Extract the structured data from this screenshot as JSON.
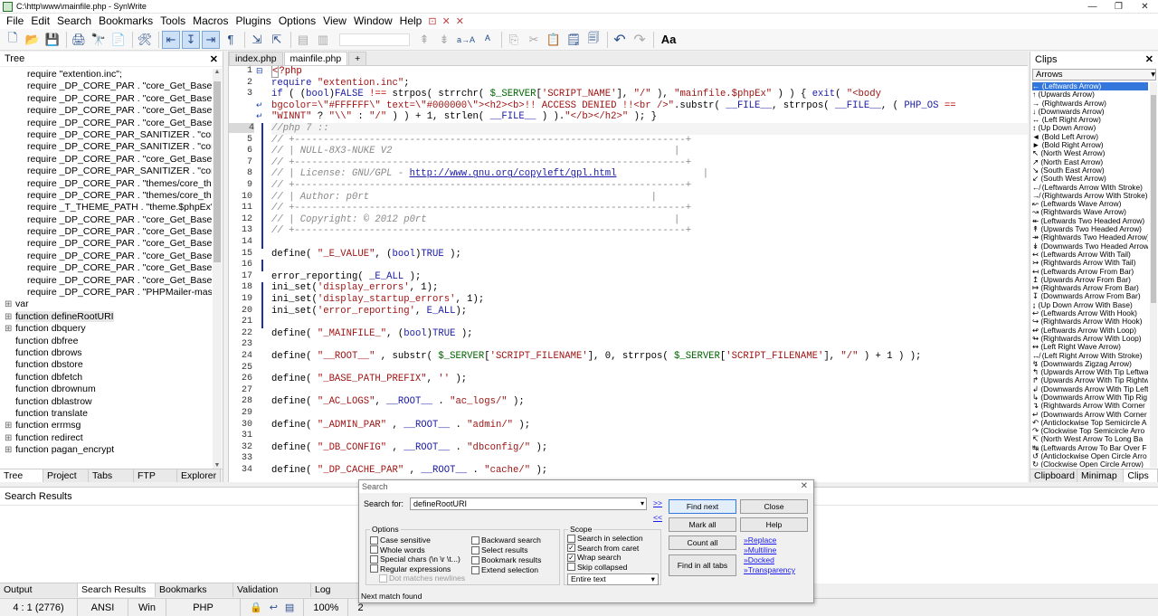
{
  "window": {
    "title": "C:\\http\\www\\mainfile.php - SynWrite",
    "controls": [
      "—",
      "❐",
      "✕"
    ]
  },
  "menu": {
    "items": [
      "File",
      "Edit",
      "Search",
      "Bookmarks",
      "Tools",
      "Macros",
      "Plugins",
      "Options",
      "View",
      "Window",
      "Help"
    ],
    "extras": [
      "⊡",
      "✕",
      "✕"
    ]
  },
  "toolbar": {
    "icons": [
      "new-file-icon",
      "open-icon",
      "save-icon",
      "print-icon",
      "binoculars-icon",
      "export-icon",
      "tools-icon",
      "indent-left-icon",
      "indent-wrap-icon",
      "indent-right-icon",
      "pilcrow-icon",
      "indent-icon",
      "unindent-icon",
      "comment-icon",
      "uncomment-icon",
      "search-box",
      "search-prev-icon",
      "search-next-icon",
      "replace-icon",
      "case-icon",
      "copy-icon",
      "cut-icon",
      "paste-icon",
      "clipboard-icon",
      "clipboard2-icon",
      "undo-icon",
      "redo-icon",
      "font-size-icon"
    ],
    "glyphs": [
      "🗋",
      "📂",
      "💾",
      "🖨",
      "🔭",
      "📄",
      "🛠",
      "⇤",
      "↧",
      "⇥",
      "¶",
      "⇲",
      "⇱",
      "▤",
      "▥",
      "",
      "⇞",
      "⇟",
      "a→A",
      "ᴬ",
      "⎘",
      "✂",
      "📋",
      "🗒",
      "🗐",
      "↶",
      "↷",
      "Aa"
    ]
  },
  "tree": {
    "title": "Tree",
    "child_items": [
      "require \"extention.inc\";",
      "require _DP_CORE_PAR . \"core_Get_Base_Fun",
      "require _DP_CORE_PAR . \"core_Get_Base_Fun",
      "require _DP_CORE_PAR . \"core_Get_Base_Con",
      "require _DP_CORE_PAR . \"core_Get_Base_Fun",
      "require _DP_CORE_PAR_SANITIZER . \"core_Sa",
      "require _DP_CORE_PAR_SANITIZER . \"core_Ch",
      "require _DP_CORE_PAR . \"core_Get_Base_Mob",
      "require _DP_CORE_PAR_SANITIZER . \"core_BE",
      "require _DP_CORE_PAR . \"themes/core_theme",
      "require _DP_CORE_PAR . \"themes/core_theme",
      "require _T_THEME_PATH . \"theme.$phpEx\";",
      "require _DP_CORE_PAR . \"core_Get_Base_Fun",
      "require _DP_CORE_PAR . \"core_Get_Base_Fun",
      "require _DP_CORE_PAR . \"core_Get_Base_Fun",
      "require _DP_CORE_PAR . \"core_Get_Base_Fun",
      "require _DP_CORE_PAR . \"core_Get_Base_Fun",
      "require _DP_CORE_PAR . \"core_Get_Base_Fun",
      "require _DP_CORE_PAR . \"PHPMailer-master/PI"
    ],
    "top_items": [
      {
        "label": "var",
        "expandable": true
      },
      {
        "label": "function defineRootURI",
        "expandable": true
      },
      {
        "label": "function dbquery",
        "expandable": true
      },
      {
        "label": "function dbfree",
        "expandable": false
      },
      {
        "label": "function dbrows",
        "expandable": false
      },
      {
        "label": "function dbstore",
        "expandable": false
      },
      {
        "label": "function dbfetch",
        "expandable": false
      },
      {
        "label": "function dbrownum",
        "expandable": false
      },
      {
        "label": "function dblastrow",
        "expandable": false
      },
      {
        "label": "function translate",
        "expandable": false
      },
      {
        "label": "function errmsg",
        "expandable": true
      },
      {
        "label": "function redirect",
        "expandable": true
      },
      {
        "label": "function pagan_encrypt",
        "expandable": true
      }
    ],
    "tabs": [
      "Tree",
      "Project",
      "Tabs",
      "FTP",
      "Explorer"
    ]
  },
  "editor": {
    "tabs": [
      "index.php",
      "mainfile.php"
    ],
    "active_tab": 1,
    "add_tab": "+",
    "current_line": 4
  },
  "clips": {
    "title": "Clips",
    "category": "Arrows",
    "items": [
      "← (Leftwards Arrow)",
      "↑ (Upwards Arrow)",
      "→ (Rightwards Arrow)",
      "↓ (Downwards Arrow)",
      "↔ (Left Right Arrow)",
      "↕ (Up Down Arrow)",
      "◄ (Bold Left Arrow)",
      "► (Bold Right Arrow)",
      "↖ (North West Arrow)",
      "↗ (North East Arrow)",
      "↘ (South East Arrow)",
      "↙ (South West Arrow)",
      "↚ (Leftwards Arrow With Stroke)",
      "↛ (Rightwards Arrow With Stroke)",
      "↜ (Leftwards Wave Arrow)",
      "↝ (Rightwards Wave Arrow)",
      "↞ (Leftwards Two Headed Arrow)",
      "↟ (Upwards Two Headed Arrow)",
      "↠ (Rightwards Two Headed Arrow)",
      "↡ (Downwards Two Headed Arrow)",
      "↢ (Leftwards Arrow With Tail)",
      "↣ (Rightwards Arrow With Tail)",
      "↤ (Leftwards Arrow From Bar)",
      "↥ (Upwards Arrow From Bar)",
      "↦ (Rightwards Arrow From Bar)",
      "↧ (Downwards Arrow From Bar)",
      "↨ (Up Down Arrow With Base)",
      "↩ (Leftwards Arrow With Hook)",
      "↪ (Rightwards Arrow With Hook)",
      "↫ (Leftwards Arrow With Loop)",
      "↬ (Rightwards Arrow With Loop)",
      "↭ (Left Right Wave Arrow)",
      "↮ (Left Right Arrow With Stroke)",
      "↯ (Downwards Zigzag Arrow)",
      "↰ (Upwards Arrow With Tip Leftwa",
      "↱ (Upwards Arrow With Tip Rightw",
      "↲ (Downwards Arrow With Tip Left",
      "↳ (Downwards Arrow With Tip Rig",
      "↴ (Rightwards Arrow With Corner",
      "↵ (Downwards Arrow With Corner",
      "↶ (Anticlockwise Top Semicircle A",
      "↷ (Clockwise Top Semicircle Arro",
      "↸ (North West Arrow To Long Ba",
      "↹ (Leftwards Arrow To Bar Over F",
      "↺ (Anticlockwise Open Circle Arro",
      "↻ (Clockwise Open Circle Arrow)"
    ],
    "tabs": [
      "Clipboard",
      "Minimap",
      "Clips"
    ]
  },
  "results": {
    "title": "Search Results",
    "tabs": [
      "Output",
      "Search Results",
      "Bookmarks",
      "Validation",
      "Log"
    ]
  },
  "status": {
    "position": "4 : 1 (2776)",
    "encoding": "ANSI",
    "line_ending": "Win",
    "lexer": "PHP",
    "zoom": "100%",
    "extra": "2"
  },
  "search": {
    "title": "Search",
    "search_for_label": "Search for:",
    "query": "defineRootURI",
    "link_forward": ">>",
    "link_back": "<<",
    "options_title": "Options",
    "options_left": [
      {
        "label": "Case sensitive",
        "checked": false,
        "disabled": false
      },
      {
        "label": "Whole words",
        "checked": false,
        "disabled": false
      },
      {
        "label": "Special chars (\\n \\r \\t...)",
        "checked": false,
        "disabled": false
      },
      {
        "label": "Regular expressions",
        "checked": false,
        "disabled": false
      },
      {
        "label": "Dot matches newlines",
        "checked": false,
        "disabled": true
      }
    ],
    "options_right": [
      {
        "label": "Backward search",
        "checked": false
      },
      {
        "label": "Select results",
        "checked": false
      },
      {
        "label": "Bookmark results",
        "checked": false
      },
      {
        "label": "Extend selection",
        "checked": false
      }
    ],
    "scope_title": "Scope",
    "scope": [
      {
        "label": "Search in selection",
        "checked": false
      },
      {
        "label": "Search from caret",
        "checked": true
      },
      {
        "label": "Wrap search",
        "checked": true
      },
      {
        "label": "Skip collapsed",
        "checked": false
      }
    ],
    "scope_select": "Entire text",
    "buttons": {
      "find_next": "Find next",
      "close": "Close",
      "mark_all": "Mark all",
      "help": "Help",
      "count_all": "Count all",
      "find_in_all_tabs": "Find in all tabs"
    },
    "links": [
      "»Replace",
      "»Multiline",
      "»Docked",
      "»Transparency"
    ],
    "status_text": "Next match found",
    "close_glyph": "✕"
  }
}
